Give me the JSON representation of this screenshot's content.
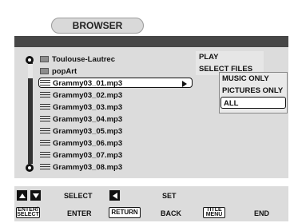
{
  "window": {
    "title": "BROWSER"
  },
  "list": {
    "items": [
      {
        "type": "folder",
        "label": "Toulouse-Lautrec"
      },
      {
        "type": "folder",
        "label": "popArt"
      },
      {
        "type": "file",
        "label": "Grammy03_01.mp3",
        "selected": true
      },
      {
        "type": "file",
        "label": "Grammy03_02.mp3"
      },
      {
        "type": "file",
        "label": "Grammy03_03.mp3"
      },
      {
        "type": "file",
        "label": "Grammy03_04.mp3"
      },
      {
        "type": "file",
        "label": "Grammy03_05.mp3"
      },
      {
        "type": "file",
        "label": "Grammy03_06.mp3"
      },
      {
        "type": "file",
        "label": "Grammy03_07.mp3"
      },
      {
        "type": "file",
        "label": "Grammy03_08.mp3"
      }
    ]
  },
  "context_menu": {
    "items": [
      "PLAY",
      "SELECT FILES"
    ]
  },
  "filter_menu": {
    "items": [
      "MUSIC ONLY",
      "PICTURES ONLY",
      "ALL"
    ],
    "selected": "ALL"
  },
  "footer": {
    "row1": {
      "select_label": "SELECT",
      "set_label": "SET"
    },
    "row2": {
      "enter_key_line1": "ENTER/",
      "enter_key_line2": "SELECT",
      "enter_label": "ENTER",
      "return_key": "RETURN",
      "back_label": "BACK",
      "title_key_line1": "TITLE",
      "title_key_line2": "MENU",
      "end_label": "END"
    }
  },
  "icons": {
    "up": "up-arrow-icon",
    "down": "down-arrow-icon",
    "left": "left-arrow-icon",
    "play": "play-arrow-icon"
  }
}
